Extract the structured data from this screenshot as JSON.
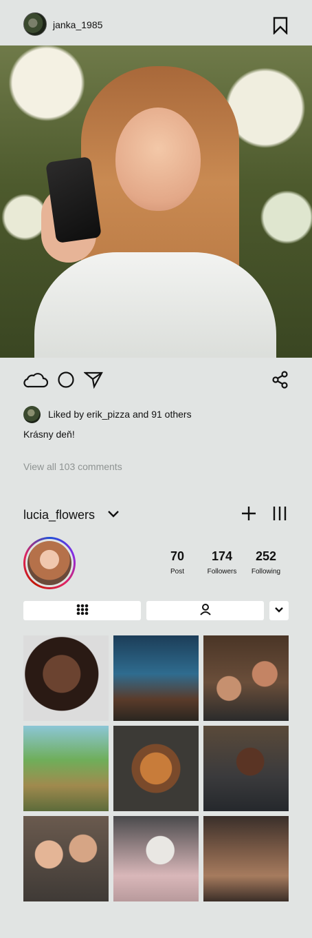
{
  "header": {
    "username": "janka_1985"
  },
  "post": {
    "liked_by_text": "Liked by erik_pizza and 91 others",
    "caption": "Krásny deň!",
    "view_comments": "View all 103 comments"
  },
  "profile": {
    "username": "lucia_flowers",
    "stats": [
      {
        "value": "70",
        "label": "Post"
      },
      {
        "value": "174",
        "label": "Followers"
      },
      {
        "value": "252",
        "label": "Following"
      }
    ]
  },
  "icons": {
    "bookmark": "bookmark-icon",
    "like": "cloud-icon",
    "comment": "circle-icon",
    "send": "send-icon",
    "share": "share-icon",
    "grid": "grid-icon",
    "tagged": "person-icon"
  },
  "colors": {
    "background": "#e1e4e3",
    "muted_text": "#8e9392",
    "story_ring_start": "#1d4fd8",
    "story_ring_end": "#e0245e"
  }
}
